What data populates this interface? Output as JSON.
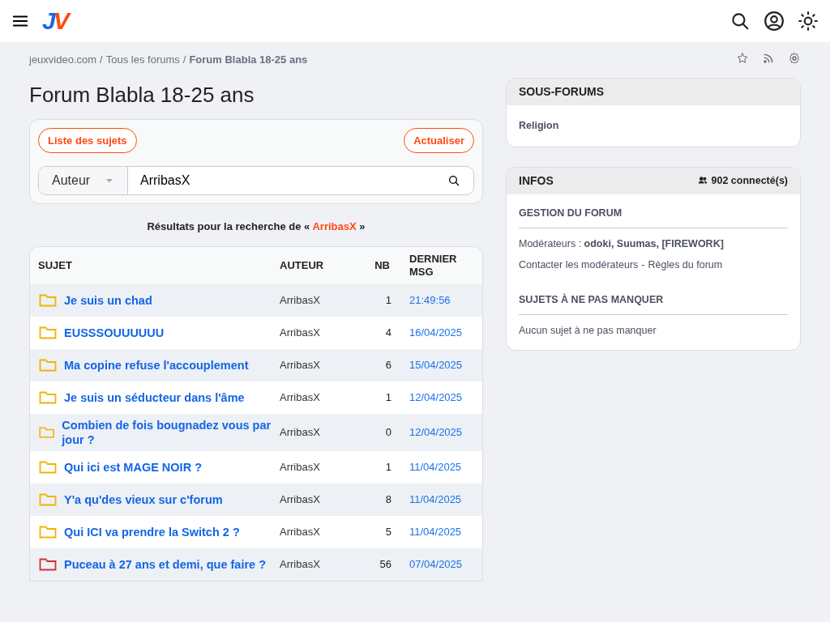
{
  "header": {
    "logo": [
      "J",
      "V"
    ]
  },
  "breadcrumb_separator": "/",
  "breadcrumb": [
    {
      "label": "jeuxvideo.com",
      "current": false
    },
    {
      "label": "Tous les forums",
      "current": false
    },
    {
      "label": "Forum Blabla 18-25 ans",
      "current": true
    }
  ],
  "title": "Forum Blabla 18-25 ans",
  "toolbar": {
    "buttons": [
      "Liste des sujets",
      "Actualiser"
    ],
    "search_type": "Auteur",
    "search_value": "ArribasX"
  },
  "results": {
    "prefix": "Résultats pour la recherche de «",
    "term": "ArribasX",
    "suffix": "»"
  },
  "table": {
    "columns": [
      "SUJET",
      "AUTEUR",
      "NB",
      "DERNIER MSG"
    ],
    "rows": [
      {
        "subject": "Je suis un chad",
        "author": "ArribasX",
        "count": "1",
        "last": "21:49:56",
        "color": "#f0b400"
      },
      {
        "subject": "EUSSSOUUUUUU",
        "author": "ArribasX",
        "count": "4",
        "last": "16/04/2025",
        "color": "#f0b400"
      },
      {
        "subject": "Ma copine refuse l'accouplement",
        "author": "ArribasX",
        "count": "6",
        "last": "15/04/2025",
        "color": "#f0b400"
      },
      {
        "subject": "Je suis un séducteur dans l'âme",
        "author": "ArribasX",
        "count": "1",
        "last": "12/04/2025",
        "color": "#f0b400"
      },
      {
        "subject": "Combien de fois bougnadez vous par jour ?",
        "author": "ArribasX",
        "count": "0",
        "last": "12/04/2025",
        "color": "#f0b400"
      },
      {
        "subject": "Qui ici est MAGE NOIR ?",
        "author": "ArribasX",
        "count": "1",
        "last": "11/04/2025",
        "color": "#f0b400"
      },
      {
        "subject": "Y'a qu'des vieux sur c'forum",
        "author": "ArribasX",
        "count": "8",
        "last": "11/04/2025",
        "color": "#f0b400"
      },
      {
        "subject": "Qui ICI va prendre la Switch 2 ?",
        "author": "ArribasX",
        "count": "5",
        "last": "11/04/2025",
        "color": "#f0b400"
      },
      {
        "subject": "Puceau à 27 ans et demi, que faire ?",
        "author": "ArribasX",
        "count": "56",
        "last": "07/04/2025",
        "color": "#d32f2f"
      }
    ]
  },
  "subforums": {
    "title": "SOUS-FORUMS",
    "items": [
      "Religion"
    ]
  },
  "infos": {
    "title": "INFOS",
    "online": "902 connecté(s)",
    "management_title": "GESTION DU FORUM",
    "moderators": "Modérateurs : **odoki, Suumas, [FIREWORK]**",
    "links": [
      "Contacter les modérateurs",
      "Règles du forum"
    ],
    "separator": "-",
    "featured_title": "SUJETS À NE PAS MANQUER",
    "featured_empty": "Aucun sujet à ne pas manquer"
  }
}
